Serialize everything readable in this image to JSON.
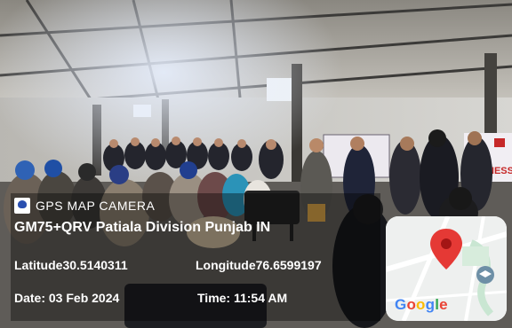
{
  "overlay": {
    "app_name": "GPS MAP CAMERA",
    "location": "GM75+QRV Patiala Division Punjab IN",
    "latitude": "Latitude30.5140311",
    "longitude": "Longitude76.6599197",
    "date": "Date: 03 Feb 2024",
    "time": "Time: 11:54 AM"
  },
  "map": {
    "brand": [
      "G",
      "o",
      "o",
      "g",
      "l",
      "e"
    ],
    "pin_color": "#e53935"
  },
  "banner": {
    "partial_text": "NESS"
  },
  "icons": [
    "app-logo-icon",
    "map-pin-icon",
    "graduation-cap-icon"
  ]
}
